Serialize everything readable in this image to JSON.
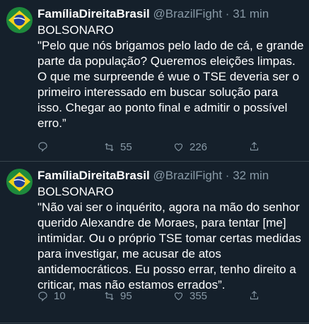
{
  "tweets": [
    {
      "display_name": "FamíliaDireitaBrasil",
      "handle": "@BrazilFight",
      "separator": "·",
      "time": "31 min",
      "title": "BOLSONARO",
      "text": "\"Pelo que nós brigamos pelo lado de cá, e grande parte da população? Queremos eleições limpas. O que me surpreende é wue o TSE deveria ser o primeiro interessado em buscar solução para isso. Chegar ao ponto final e admitir o possível erro.”",
      "replies": "",
      "retweets": "55",
      "likes": "226",
      "icons": [
        "reply-icon",
        "retweet-icon",
        "like-icon",
        "share-icon"
      ]
    },
    {
      "display_name": "FamíliaDireitaBrasil",
      "handle": "@BrazilFight",
      "separator": "·",
      "time": "32 min",
      "title": "BOLSONARO",
      "text": "\"Não vai ser o inquérito, agora na mão do senhor querido Alexandre de Moraes, para tentar [me] intimidar. Ou o próprio TSE tomar certas medidas para investigar, me acusar de atos antidemocráticos. Eu posso errar, tenho direito a criticar, mas não estamos errados”.",
      "replies": "10",
      "retweets": "95",
      "likes": "355",
      "icons": [
        "reply-icon",
        "retweet-icon",
        "like-icon",
        "share-icon"
      ]
    }
  ],
  "colors": {
    "background": "#15202b",
    "text": "#ffffff",
    "secondary": "#8899a6",
    "divider": "#38444d",
    "avatar_green": "#1e8a3c",
    "avatar_yellow": "#f2d21a",
    "avatar_blue": "#1f3f9a"
  }
}
